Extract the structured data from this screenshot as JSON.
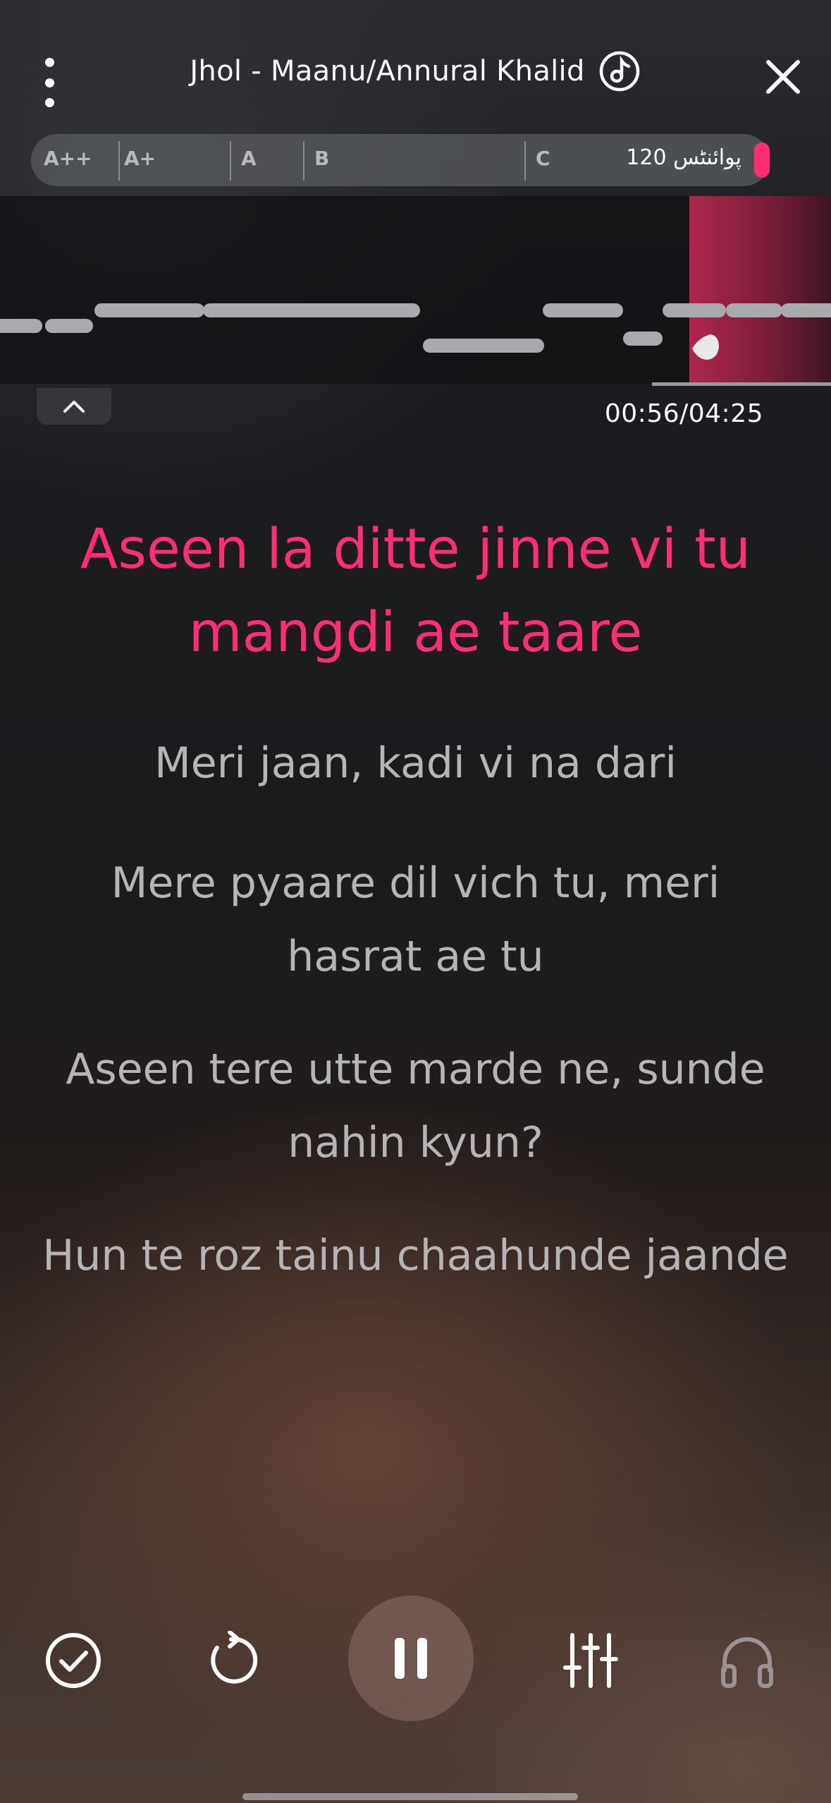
{
  "header": {
    "song_title": "Jhol - Maanu/Annural Khalid",
    "menu_icon": "more-vertical-icon",
    "mode_icon": "music-note-circle-icon",
    "close_icon": "close-icon"
  },
  "score": {
    "grades": [
      "A++",
      "A+",
      "A",
      "B",
      "C"
    ],
    "points_label": "120 پوائنٹس",
    "accent_color": "#ff2d6f"
  },
  "playback": {
    "time": "00:56/04:25"
  },
  "lyrics": {
    "current": "Aseen la ditte jinne vi tu mangdi ae taare",
    "upcoming": [
      "Meri jaan, kadi vi na dari",
      "Mere pyaare dil vich tu, meri hasrat ae tu",
      "Aseen tere utte marde ne, sunde nahin kyun?",
      "Hun te roz tainu chaahunde jaande"
    ]
  },
  "controls": {
    "finish_icon": "check-circle-icon",
    "restart_icon": "restart-icon",
    "pause_icon": "pause-icon",
    "mixer_icon": "equalizer-sliders-icon",
    "headphones_icon": "headphones-icon"
  }
}
